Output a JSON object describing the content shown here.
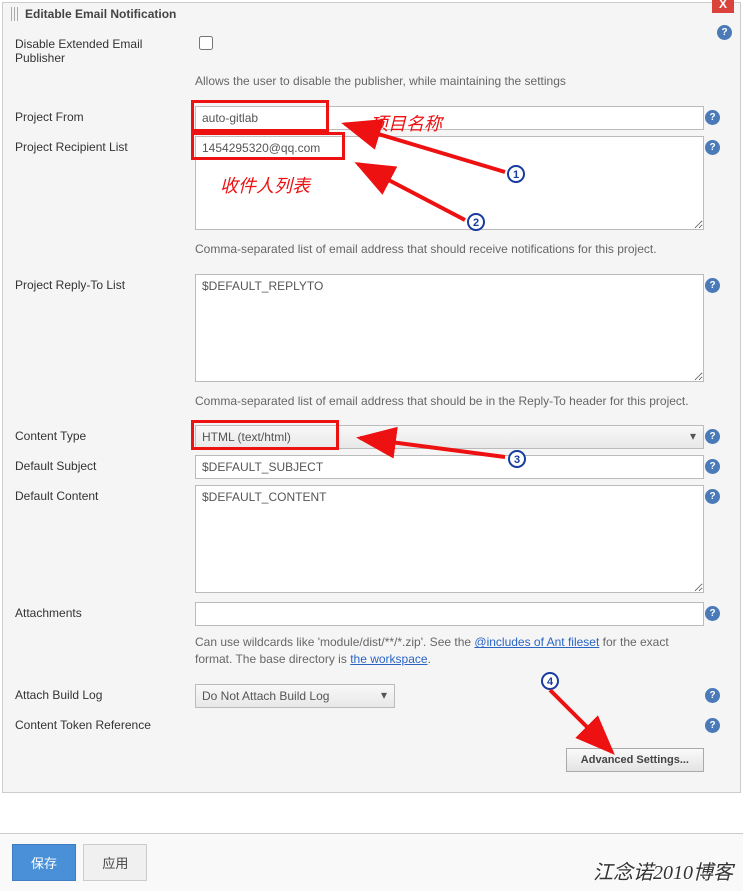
{
  "panel": {
    "title": "Editable Email Notification"
  },
  "labels": {
    "disable_publisher": "Disable Extended Email Publisher",
    "project_from": "Project From",
    "recipient_list": "Project Recipient List",
    "reply_to": "Project Reply-To List",
    "content_type": "Content Type",
    "default_subject": "Default Subject",
    "default_content": "Default Content",
    "attachments": "Attachments",
    "attach_build_log": "Attach Build Log",
    "content_token_ref": "Content Token Reference"
  },
  "values": {
    "project_from": "auto-gitlab",
    "recipient_list": "1454295320@qq.com",
    "reply_to": "$DEFAULT_REPLYTO",
    "content_type": "HTML (text/html)",
    "default_subject": "$DEFAULT_SUBJECT",
    "default_content": "$DEFAULT_CONTENT",
    "attachments": "",
    "attach_build_log": "Do Not Attach Build Log"
  },
  "hints": {
    "disable_publisher": "Allows the user to disable the publisher, while maintaining the settings",
    "recipient_list": "Comma-separated list of email address that should receive notifications for this project.",
    "reply_to": "Comma-separated list of email address that should be in the Reply-To header for this project.",
    "attachments_pre": "Can use wildcards like 'module/dist/**/*.zip'. See the ",
    "attachments_link1": "@includes of Ant fileset",
    "attachments_mid": " for the exact format. The base directory is ",
    "attachments_link2": "the workspace",
    "attachments_post": "."
  },
  "buttons": {
    "advanced": "Advanced Settings...",
    "save": "保存",
    "apply": "应用"
  },
  "annotations": {
    "project_name": "项目名称",
    "recipient_list": "收件人列表",
    "num1": "1",
    "num2": "2",
    "num3": "3",
    "num4": "4"
  },
  "watermark": "江念诺2010博客",
  "help_glyph": "?"
}
